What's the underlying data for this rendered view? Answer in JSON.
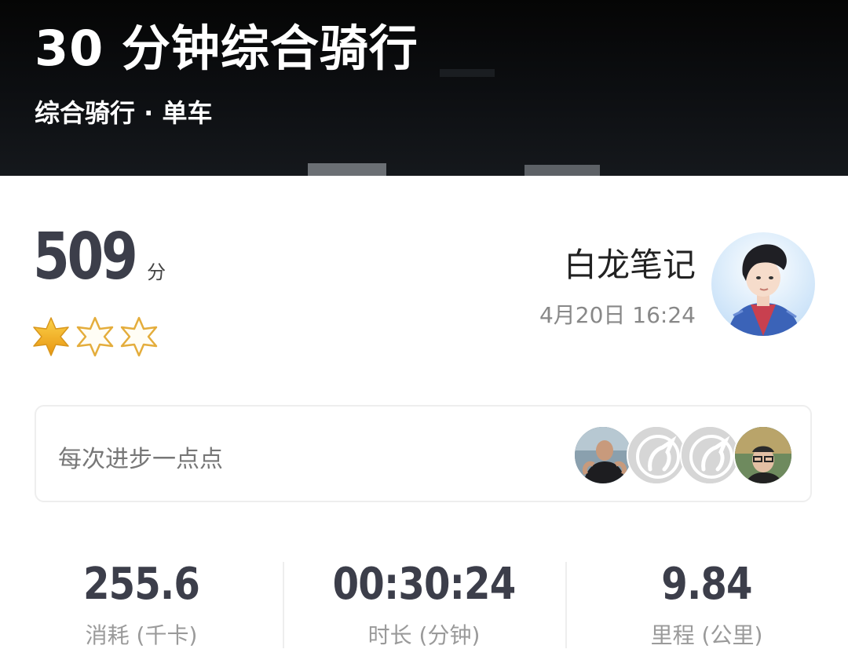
{
  "header": {
    "title": "30 分钟综合骑行",
    "subtitle": "综合骑行 · 单车"
  },
  "score": {
    "value": "509",
    "unit": "分",
    "stars_filled": 1,
    "stars_total": 3
  },
  "user": {
    "name": "白龙笔记",
    "datetime": "4月20日 16:24"
  },
  "motto_card": {
    "text": "每次进步一点点",
    "avatars": [
      "user-photo",
      "unicorn-icon",
      "unicorn-icon",
      "user-photo"
    ]
  },
  "stats": [
    {
      "value": "255.6",
      "label": "消耗 (千卡)"
    },
    {
      "value": "00:30:24",
      "label": "时长 (分钟)"
    },
    {
      "value": "9.84",
      "label": "里程 (公里)"
    }
  ],
  "colors": {
    "star_gold": "#f2b01e",
    "star_outline": "#e9b23a",
    "text_dark": "#3c3e4a",
    "text_muted": "#9a9a9a"
  }
}
